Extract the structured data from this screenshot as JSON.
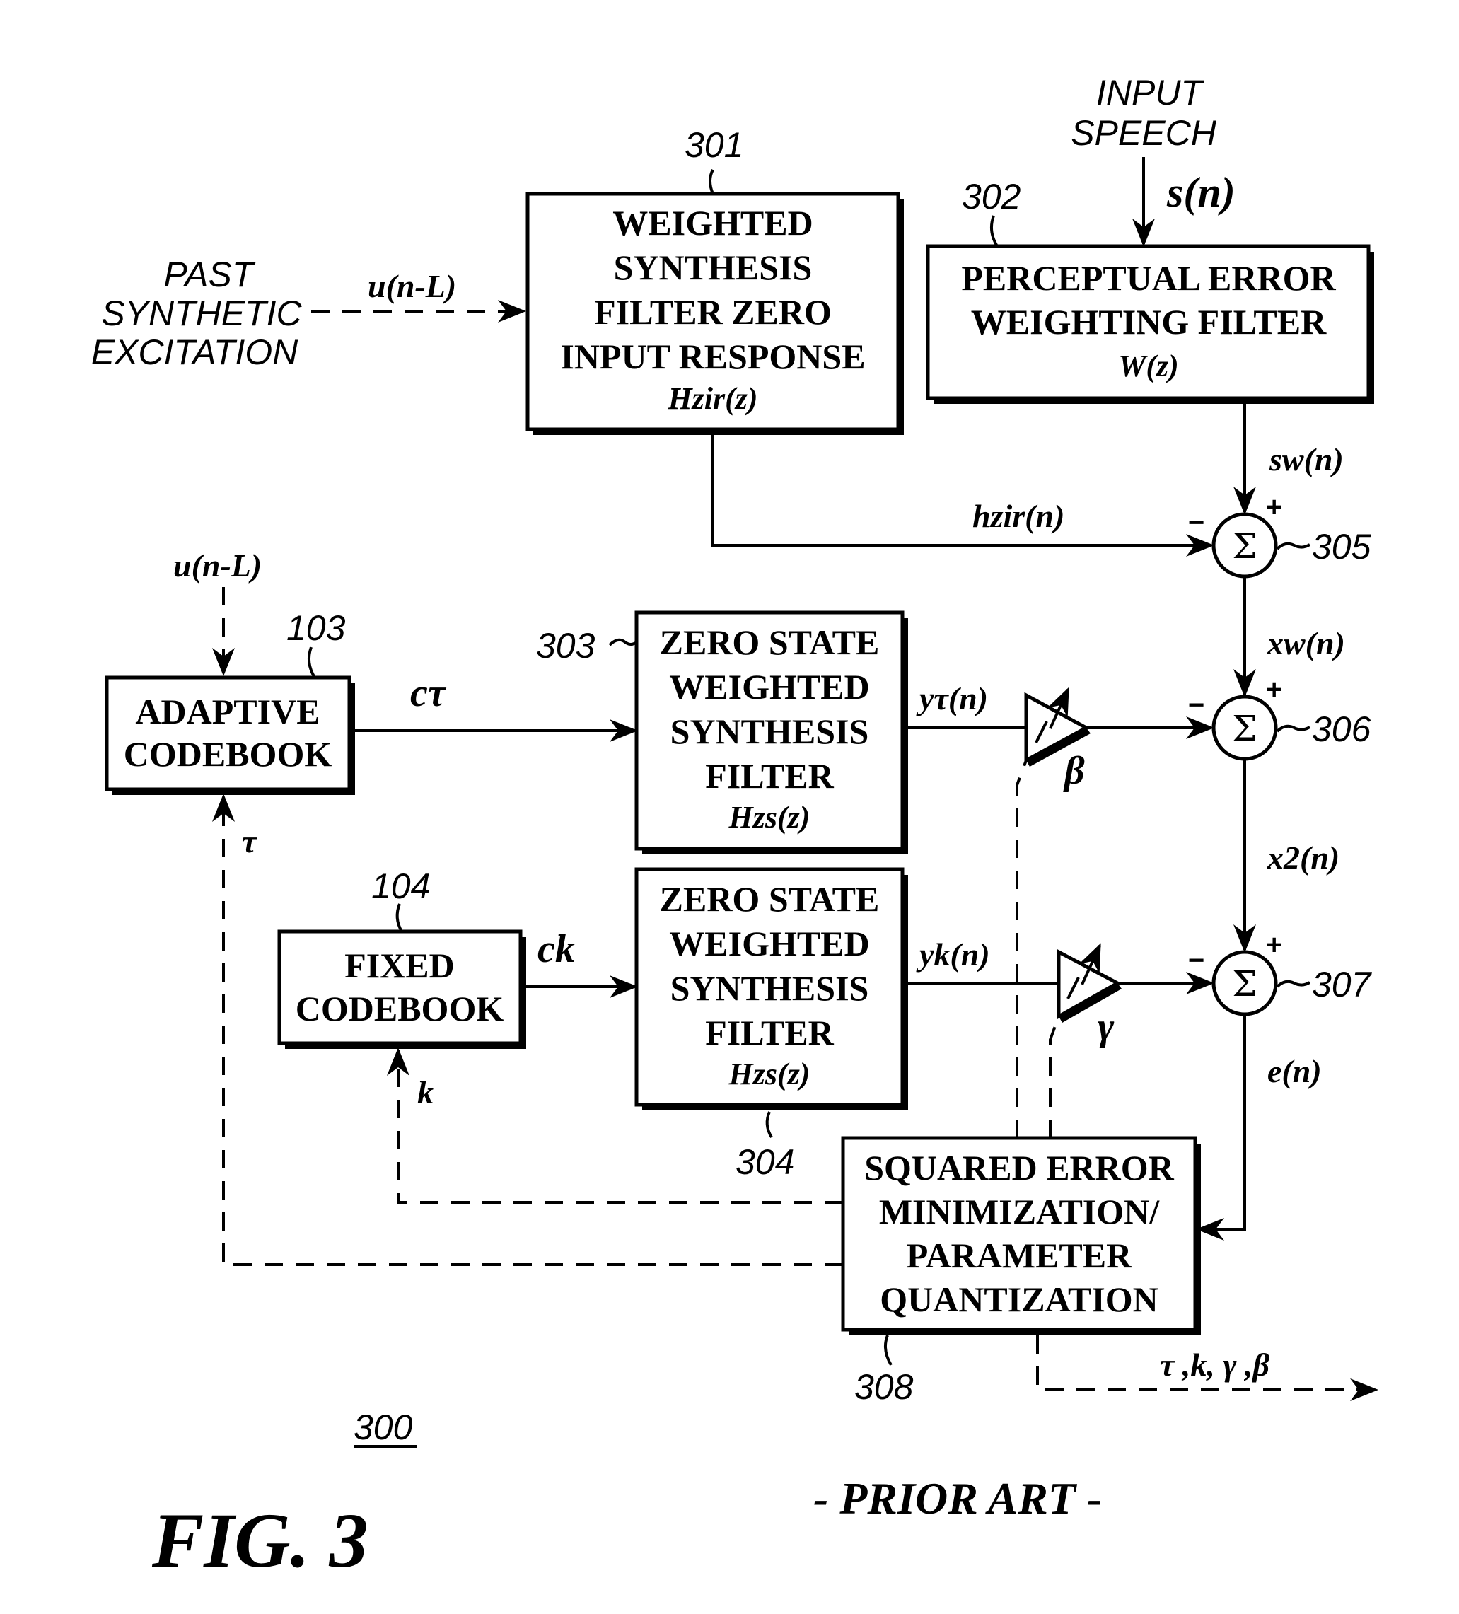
{
  "figure": {
    "title": "FIG. 3",
    "subtitle": "- PRIOR ART -",
    "reference": "300"
  },
  "inputs": {
    "past_excitation": [
      "PAST",
      "SYNTHETIC",
      "EXCITATION"
    ],
    "input_speech": [
      "INPUT",
      "SPEECH"
    ]
  },
  "blocks": {
    "b301": {
      "ref": "301",
      "lines": [
        "WEIGHTED",
        "SYNTHESIS",
        "FILTER ZERO",
        "INPUT RESPONSE"
      ],
      "func": "Hzir(z)"
    },
    "b302": {
      "ref": "302",
      "lines": [
        "PERCEPTUAL ERROR",
        "WEIGHTING FILTER"
      ],
      "func": "W(z)"
    },
    "b103": {
      "ref": "103",
      "lines": [
        "ADAPTIVE",
        "CODEBOOK"
      ]
    },
    "b104": {
      "ref": "104",
      "lines": [
        "FIXED",
        "CODEBOOK"
      ]
    },
    "b303": {
      "ref": "303",
      "lines": [
        "ZERO STATE",
        "WEIGHTED",
        "SYNTHESIS",
        "FILTER"
      ],
      "func": "Hzs(z)"
    },
    "b304": {
      "ref": "304",
      "lines": [
        "ZERO STATE",
        "WEIGHTED",
        "SYNTHESIS",
        "FILTER"
      ],
      "func": "Hzs(z)"
    },
    "b308": {
      "ref": "308",
      "lines": [
        "SQUARED ERROR",
        "MINIMIZATION/",
        "PARAMETER",
        "QUANTIZATION"
      ]
    }
  },
  "summers": {
    "s305": {
      "ref": "305",
      "symbol": "Σ",
      "plus": "+",
      "minus": "−"
    },
    "s306": {
      "ref": "306",
      "symbol": "Σ",
      "plus": "+",
      "minus": "−"
    },
    "s307": {
      "ref": "307",
      "symbol": "Σ",
      "plus": "+",
      "minus": "−"
    }
  },
  "gains": {
    "beta": "β",
    "gamma": "γ"
  },
  "signals": {
    "u_past": "u(n-L)",
    "u_adaptive": "u(n-L)",
    "s_n": "s(n)",
    "sw": "sw(n)",
    "hzir": "hzir(n)",
    "xw": "xw(n)",
    "x2": "x2(n)",
    "en": "e(n)",
    "c_tau": "cτ",
    "c_k": "ck",
    "y_tau": "yτ(n)",
    "y_k": "yk(n)",
    "tau": "τ",
    "k": "k",
    "outputs": "τ ,k, γ ,β"
  }
}
